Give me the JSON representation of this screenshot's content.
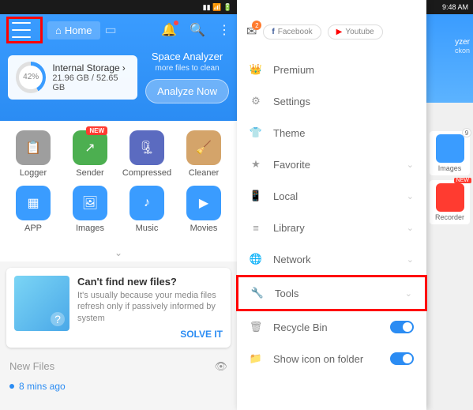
{
  "status_time": "9:48 AM",
  "header": {
    "home_label": "Home",
    "analyzer_title": "Space Analyzer",
    "analyzer_sub": "more files to clean",
    "analyze_btn": "Analyze Now"
  },
  "storage": {
    "percent": "42%",
    "title": "Internal Storage",
    "detail": "21.96 GB / 52.65 GB"
  },
  "grid": [
    {
      "label": "Logger",
      "color": "#9e9e9e",
      "badge": null
    },
    {
      "label": "Sender",
      "color": "#4caf50",
      "badge": "NEW"
    },
    {
      "label": "Compressed",
      "color": "#5b6bc0",
      "badge": null
    },
    {
      "label": "Cleaner",
      "color": "#d4a46a",
      "badge": null
    },
    {
      "label": "APP",
      "color": "#3a9cff",
      "badge": null
    },
    {
      "label": "Images",
      "color": "#3a9cff",
      "badge": null
    },
    {
      "label": "Music",
      "color": "#3a9cff",
      "badge": null
    },
    {
      "label": "Movies",
      "color": "#3a9cff",
      "badge": null
    }
  ],
  "tip": {
    "title": "Can't find new files?",
    "body": "It's usually because your media files refresh only if passively informed by system",
    "action": "SOLVE IT"
  },
  "new_files": {
    "heading": "New Files",
    "item": "8 mins ago"
  },
  "drawer": {
    "mail_count": "2",
    "facebook": "Facebook",
    "youtube": "Youtube",
    "items": [
      {
        "name": "Premium",
        "icon": "crown",
        "chev": false,
        "toggle": false,
        "highlight": false
      },
      {
        "name": "Settings",
        "icon": "gear",
        "chev": false,
        "toggle": false,
        "highlight": false
      },
      {
        "name": "Theme",
        "icon": "shirt",
        "chev": false,
        "toggle": false,
        "highlight": false
      },
      {
        "name": "Favorite",
        "icon": "star",
        "chev": true,
        "toggle": false,
        "highlight": false
      },
      {
        "name": "Local",
        "icon": "phone",
        "chev": true,
        "toggle": false,
        "highlight": false
      },
      {
        "name": "Library",
        "icon": "stack",
        "chev": true,
        "toggle": false,
        "highlight": false
      },
      {
        "name": "Network",
        "icon": "net",
        "chev": true,
        "toggle": false,
        "highlight": false
      },
      {
        "name": "Tools",
        "icon": "wrench",
        "chev": true,
        "toggle": false,
        "highlight": true
      },
      {
        "name": "Recycle Bin",
        "icon": "trash",
        "chev": false,
        "toggle": true,
        "highlight": false
      },
      {
        "name": "Show icon on folder",
        "icon": "folder",
        "chev": false,
        "toggle": true,
        "highlight": false
      }
    ]
  },
  "peek": {
    "yzer": "yzer",
    "clean": "ckon",
    "images": {
      "label": "Images",
      "count": "9"
    },
    "recorder": {
      "label": "Recorder",
      "badge": "NEW"
    }
  }
}
